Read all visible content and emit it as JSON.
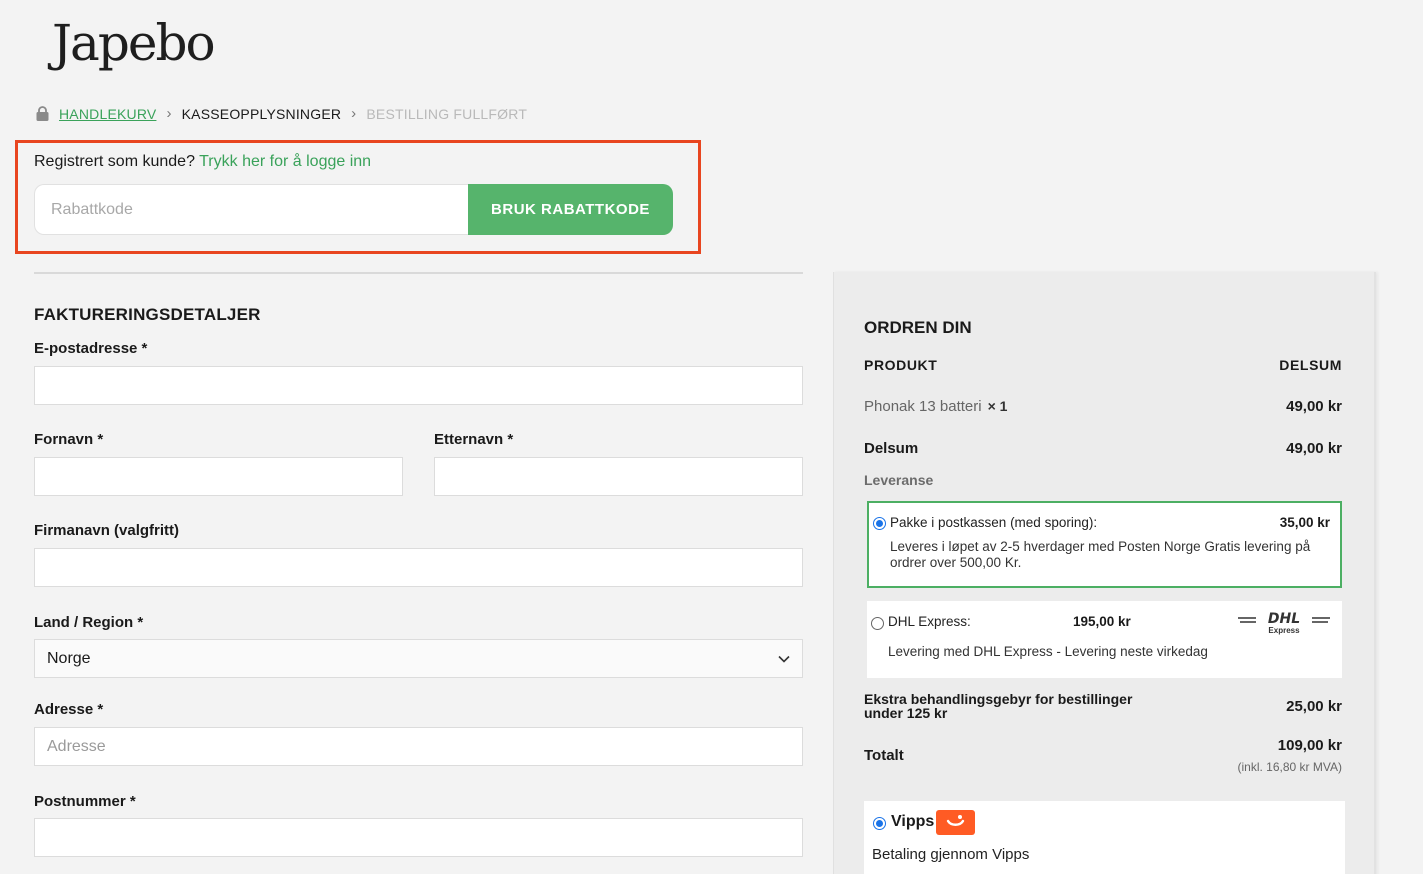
{
  "logo": {
    "text": "Japebo"
  },
  "breadcrumb": {
    "step1": "HANDLEKURV",
    "step2": "KASSEOPPLYSNINGER",
    "step3": "BESTILLING FULLFØRT"
  },
  "login": {
    "prompt": "Registrert som kunde?",
    "link": "Trykk her for å logge inn"
  },
  "coupon": {
    "placeholder": "Rabattkode",
    "button": "BRUK RABATTKODE"
  },
  "billing": {
    "title": "FAKTURERINGSDETALJER",
    "email_label": "E-postadresse *",
    "firstname_label": "Fornavn *",
    "lastname_label": "Etternavn *",
    "company_label": "Firmanavn (valgfritt)",
    "country_label": "Land / Region *",
    "country_value": "Norge",
    "address_label": "Adresse *",
    "address_placeholder": "Adresse",
    "postcode_label": "Postnummer *"
  },
  "order": {
    "title": "ORDREN DIN",
    "col_product": "PRODUKT",
    "col_subtotal": "DELSUM",
    "product_name": "Phonak 13 batteri",
    "product_qty": "× 1",
    "product_price": "49,00 kr",
    "subtotal_label": "Delsum",
    "subtotal_value": "49,00 kr",
    "shipping_label": "Leveranse",
    "shipping_options": [
      {
        "name": "Pakke i postkassen (med sporing):",
        "price": "35,00 kr",
        "desc": "Leveres i løpet av 2-5 hverdager med Posten Norge Gratis levering på ordrer over 500,00 Kr.",
        "selected": true
      },
      {
        "name": "DHL Express:",
        "price": "195,00 kr",
        "desc": "Levering med DHL Express - Levering neste virkedag",
        "logo": "DHL",
        "logo_sub": "Express",
        "selected": false
      }
    ],
    "fee_label": "Ekstra behandlingsgebyr for bestillinger under 125 kr",
    "fee_value": "25,00 kr",
    "total_label": "Totalt",
    "total_value": "109,00 kr",
    "total_vat": "(inkl. 16,80 kr MVA)"
  },
  "payment": {
    "method": "Vipps",
    "desc": "Betaling gjennom Vipps",
    "brand_color": "#ff5b24"
  },
  "colors": {
    "accent_green": "#56b46c",
    "link_green": "#3aa25a",
    "highlight": "#e8451f"
  }
}
